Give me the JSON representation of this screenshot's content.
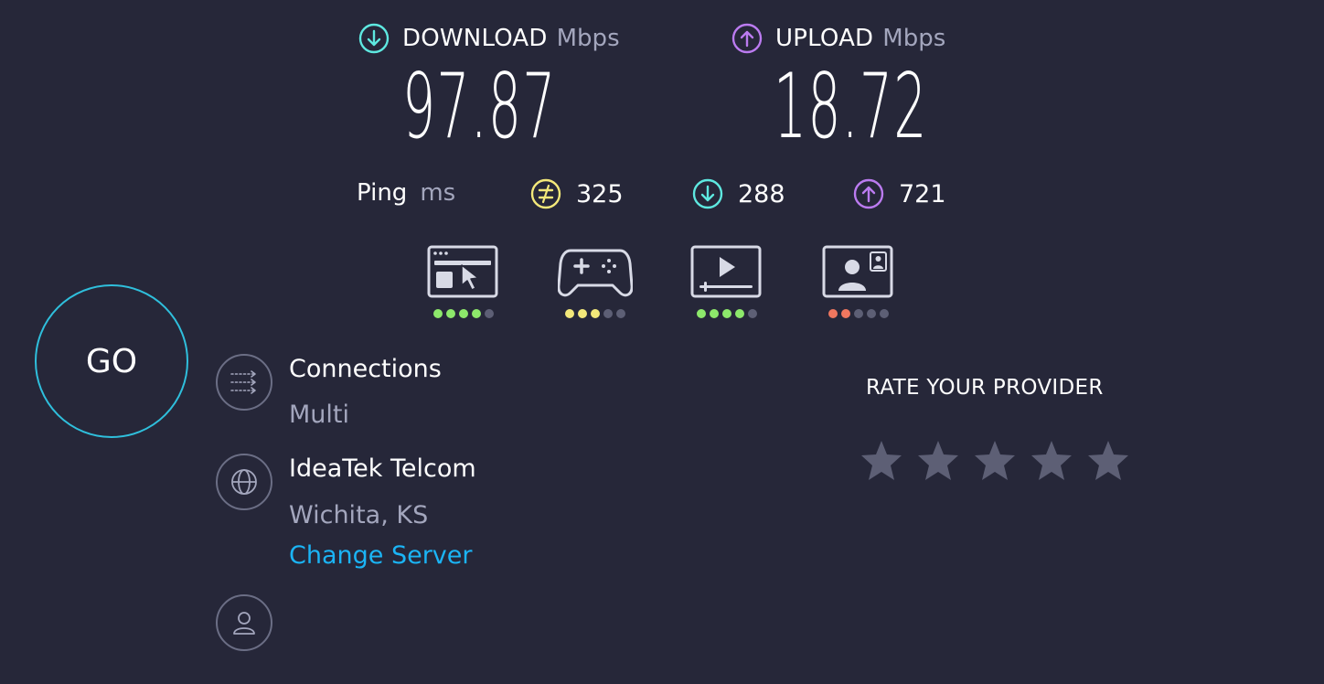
{
  "download": {
    "label": "DOWNLOAD",
    "unit": "Mbps",
    "value": "97.87",
    "icon": "arrow-down-circle-icon",
    "color": "#5ee8e0"
  },
  "upload": {
    "label": "UPLOAD",
    "unit": "Mbps",
    "value": "18.72",
    "icon": "arrow-up-circle-icon",
    "color": "#bb7bf0"
  },
  "ping": {
    "label": "Ping",
    "unit": "ms",
    "idle": {
      "value": "325",
      "icon": "idle-latency-icon",
      "color": "#f3e87a"
    },
    "download": {
      "value": "288",
      "icon": "download-latency-icon",
      "color": "#5ee8e0"
    },
    "upload": {
      "value": "721",
      "icon": "upload-latency-icon",
      "color": "#bb7bf0"
    }
  },
  "quality": [
    {
      "name": "web-browsing",
      "icon": "browser-cursor-icon",
      "level": 4,
      "max": 5,
      "color": "#8de86b"
    },
    {
      "name": "gaming",
      "icon": "gamepad-icon",
      "level": 3,
      "max": 5,
      "color": "#f3e87a"
    },
    {
      "name": "video-streaming",
      "icon": "video-play-icon",
      "level": 4,
      "max": 5,
      "color": "#8de86b"
    },
    {
      "name": "video-chat",
      "icon": "video-chat-icon",
      "level": 2,
      "max": 5,
      "color": "#f0775f"
    }
  ],
  "go_label": "GO",
  "connections": {
    "title": "Connections",
    "value": "Multi",
    "icon": "connections-icon"
  },
  "server": {
    "name": "IdeaTek Telcom",
    "location": "Wichita, KS",
    "change_label": "Change Server",
    "icon": "globe-icon"
  },
  "user": {
    "icon": "user-icon"
  },
  "rating": {
    "title": "RATE YOUR PROVIDER",
    "stars": 5,
    "star_color": "#5d5f75"
  },
  "accent": "#2fbfdc"
}
